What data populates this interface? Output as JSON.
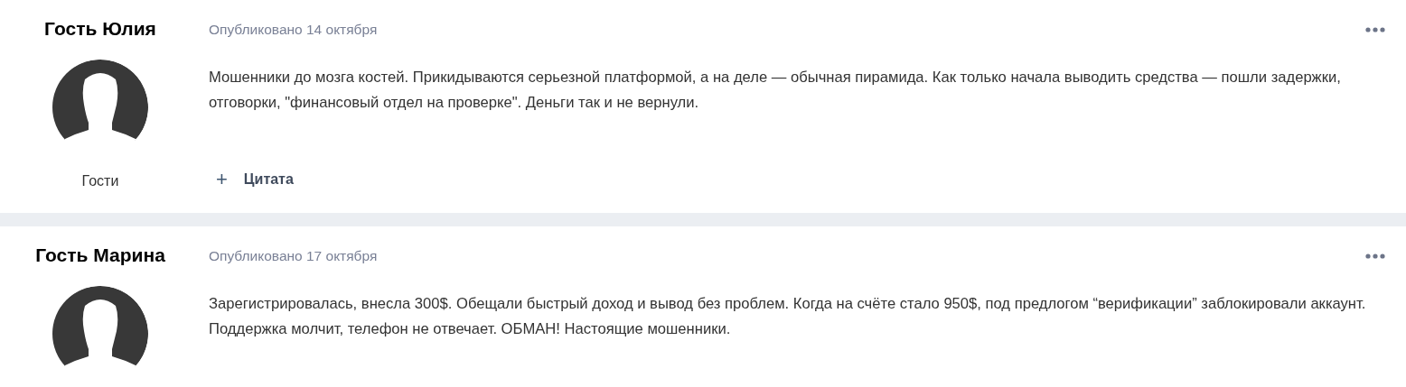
{
  "posts": [
    {
      "author": "Гость Юлия",
      "role": "Гости",
      "date": "Опубликовано 14 октября",
      "text": "Мошенники до мозга костей. Прикидываются серьезной платформой, а на деле — обычная пирамида. Как только начала выводить средства — пошли задержки, отговорки, \"финансовый отдел на проверке\". Деньги так и не вернули.",
      "quote": {
        "icon": "+",
        "label": "Цитата"
      }
    },
    {
      "author": "Гость Марина",
      "date": "Опубликовано 17 октября",
      "text": "Зарегистрировалась, внесла 300$. Обещали быстрый доход и вывод без проблем. Когда на счёте стало 950$, под предлогом “верификации” заблокировали аккаунт. Поддержка молчит, телефон не отвечает. ОБМАН! Настоящие мошенники."
    }
  ]
}
